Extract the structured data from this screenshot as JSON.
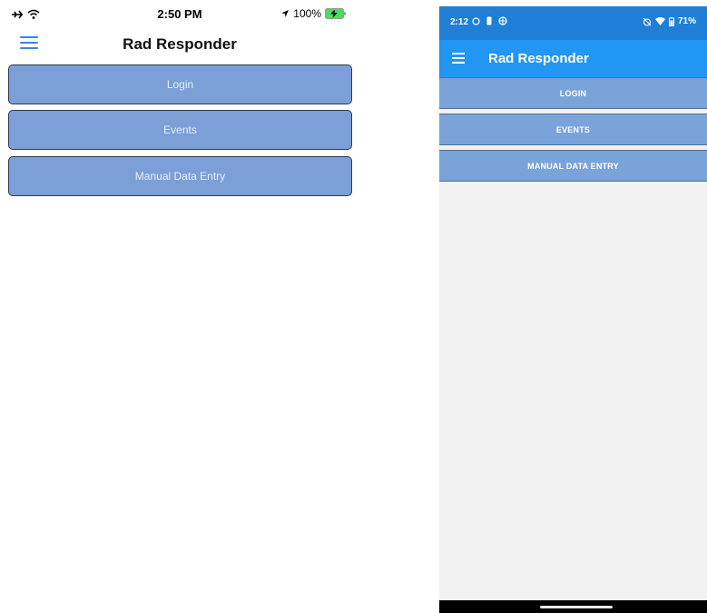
{
  "ios": {
    "status": {
      "time": "2:50 PM",
      "battery": "100%"
    },
    "title": "Rad Responder",
    "buttons": [
      {
        "label": "Login"
      },
      {
        "label": "Events"
      },
      {
        "label": "Manual Data Entry"
      }
    ],
    "icons": [
      "airplane-icon",
      "wifi-icon",
      "location-arrow-icon",
      "battery-charging-icon",
      "hamburger-menu-icon"
    ],
    "colors": {
      "menu": "#3b82e0",
      "button": "#7b9fd6",
      "button_border": "#2d3a52"
    }
  },
  "android": {
    "status": {
      "time": "2:12",
      "battery": "71%"
    },
    "title": "Rad Responder",
    "buttons": [
      {
        "label": "LOGIN"
      },
      {
        "label": "EVENTS"
      },
      {
        "label": "MANUAL DATA ENTRY"
      }
    ],
    "icons": [
      "circle-icon",
      "sim-icon",
      "globe-icon",
      "alarm-off-icon",
      "wifi-icon",
      "battery-icon",
      "hamburger-menu-icon"
    ],
    "colors": {
      "status_bar": "#1f7fd6",
      "app_bar": "#2196f3",
      "button": "#7aa3da",
      "background": "#f2f2f2"
    }
  }
}
